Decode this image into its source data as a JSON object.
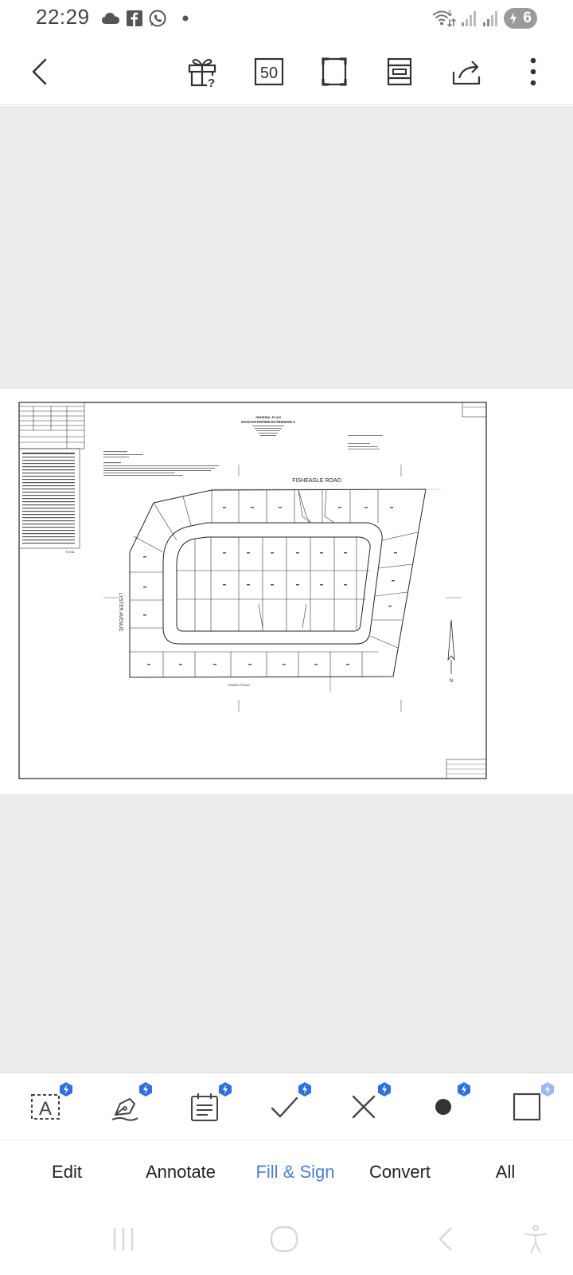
{
  "status_bar": {
    "time": "22:29",
    "left_icons": [
      "cloud-icon",
      "facebook-icon",
      "whatsapp-icon",
      "dot-icon"
    ],
    "wifi_badge": "5",
    "battery_level": "6"
  },
  "toolbar": {
    "icons": [
      "back-icon",
      "gift-help-icon",
      "zoom-icon",
      "fullscreen-icon",
      "page-layout-icon",
      "share-icon",
      "more-icon"
    ],
    "zoom_value": "50"
  },
  "document": {
    "title_line1": "GENERAL PLAN",
    "title_line2": "DAGGAFONTEIN EXTENSION 2",
    "road_top": "FISHEAGLE ROAD",
    "road_left": "LYSTER AVENUE",
    "road_bottom": "SWANS ROAD",
    "north_label": "N",
    "table_footer": "TOTAL"
  },
  "bottom_tools": {
    "icons": [
      "edit-text-icon",
      "annotate-pen-icon",
      "fill-form-icon",
      "checkmark-icon",
      "cross-icon",
      "dot-icon",
      "rectangle-icon"
    ],
    "badge_color": "#2f6fe0"
  },
  "tabs": {
    "items": [
      {
        "label": "Edit"
      },
      {
        "label": "Annotate"
      },
      {
        "label": "Fill & Sign"
      },
      {
        "label": "Convert"
      },
      {
        "label": "All"
      }
    ],
    "active_index": 2,
    "active_color": "#4a80d0"
  },
  "nav_bar": {
    "icons": [
      "recent-apps-icon",
      "home-icon",
      "back-nav-icon",
      "accessibility-icon"
    ]
  }
}
